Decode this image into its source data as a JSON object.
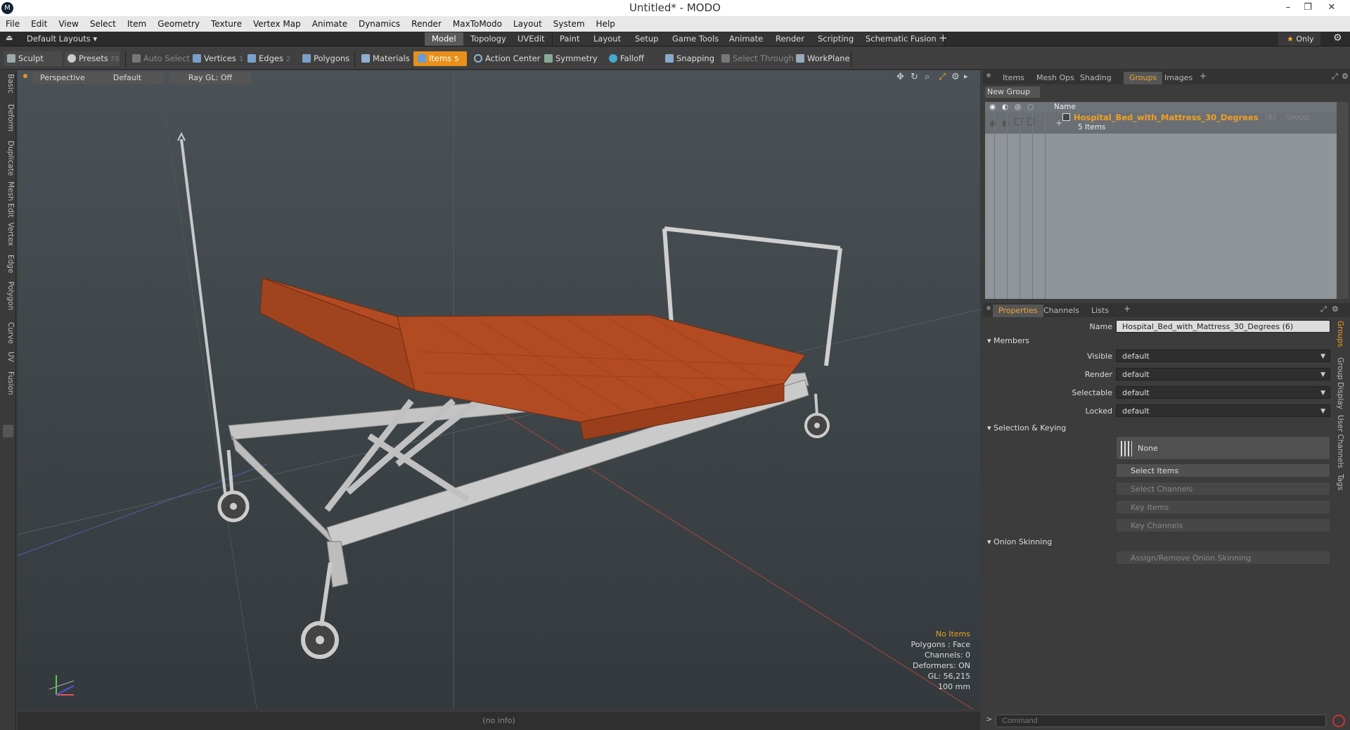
{
  "window": {
    "title": "Untitled* - MODO",
    "logo": "M"
  },
  "menu": [
    "File",
    "Edit",
    "View",
    "Select",
    "Item",
    "Geometry",
    "Texture",
    "Vertex Map",
    "Animate",
    "Dynamics",
    "Render",
    "MaxToModo",
    "Layout",
    "System",
    "Help"
  ],
  "layouts": {
    "label": "Default Layouts ▾",
    "tabs": [
      "Model",
      "Topology",
      "UVEdit",
      "Paint",
      "Layout",
      "Setup",
      "Game Tools",
      "Animate",
      "Render",
      "Scripting",
      "Schematic Fusion"
    ],
    "active": "Model",
    "only_label": "Only"
  },
  "toolbar": {
    "sculpt": "Sculpt",
    "presets": "Presets",
    "presets_key": "F6",
    "auto_select": "Auto Select",
    "vertices": "Vertices",
    "vertices_num": "1",
    "edges": "Edges",
    "edges_num": "2",
    "polygons": "Polygons",
    "materials": "Materials",
    "items": "Items",
    "items_num": "5",
    "action_center": "Action Center",
    "symmetry": "Symmetry",
    "falloff": "Falloff",
    "snapping": "Snapping",
    "select_through": "Select Through",
    "workplane": "WorkPlane"
  },
  "left_tabs": [
    "Basic",
    "Deform",
    "Duplicate",
    "Mesh Edit",
    "Vertex",
    "Edge",
    "Polygon",
    "Curve",
    "UV",
    "Fusion"
  ],
  "viewport": {
    "perspective": "Perspective",
    "shading": "Default",
    "raygl": "Ray GL: Off",
    "stats": {
      "items": "No Items",
      "polygons": "Polygons : Face",
      "channels": "Channels: 0",
      "deformers": "Deformers: ON",
      "gl": "GL: 56,215",
      "scale": "100 mm"
    },
    "footer": "(no info)"
  },
  "top_panel": {
    "tabs": [
      "Items",
      "Mesh Ops",
      "Shading",
      "Groups",
      "Images"
    ],
    "active": "Groups",
    "new_group": "New Group",
    "name_col": "Name",
    "group": {
      "name": "Hospital_Bed_with_Mattress_30_Degrees",
      "count": "(6)",
      "type": ": Group",
      "sub": "5 Items"
    }
  },
  "properties": {
    "tabs": [
      "Properties",
      "Channels",
      "Lists"
    ],
    "active": "Properties",
    "name_label": "Name",
    "name_value": "Hospital_Bed_with_Mattress_30_Degrees (6)",
    "members": "Members",
    "rows": [
      {
        "label": "Visible",
        "value": "default"
      },
      {
        "label": "Render",
        "value": "default"
      },
      {
        "label": "Selectable",
        "value": "default"
      },
      {
        "label": "Locked",
        "value": "default"
      }
    ],
    "sel_keying": "Selection & Keying",
    "none": "None",
    "select_items": "Select Items",
    "select_channels": "Select Channels",
    "key_items": "Key Items",
    "key_channels": "Key Channels",
    "onion": "Onion Skinning",
    "assign_onion": "Assign/Remove Onion Skinning",
    "side_tabs": [
      "Groups",
      "Group Display",
      "User Channels",
      "Tags"
    ]
  },
  "command": {
    "prompt": ">",
    "placeholder": "Command"
  },
  "colors": {
    "accent": "#e8901a",
    "mattress": "#b24a22",
    "frame": "#c9c9c9"
  }
}
